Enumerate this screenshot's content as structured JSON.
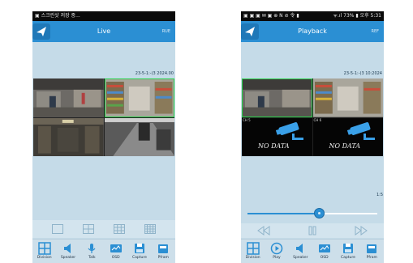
{
  "live": {
    "status_bar": {
      "left": "▣ 스크린샷 저장 중...",
      "right": ""
    },
    "title": "Live",
    "header_right": "RUE",
    "timestamp": "23-5-1:-(3 2024.00",
    "toolbar": [
      "Division",
      "Speaker",
      "Talk",
      "OSD",
      "Capture",
      "Pfram"
    ]
  },
  "playback": {
    "status_bar": {
      "left": "▣ ▣ ▣ ✉ ▣ ⊕ N ⊘ 令 ▮",
      "right": "ᯤ.ıl 73% ▮ 오후 5:31"
    },
    "title": "Playback",
    "header_right": "REF",
    "timestamp": "23-5-1:-(3 10:2024",
    "nodata_text": "NO DATA",
    "channel_labels": [
      "CH 5",
      "CH 6"
    ],
    "side_label": "1:5",
    "progress": 0.55,
    "toolbar": [
      "Division",
      "Play",
      "Speaker",
      "OSD",
      "Capture",
      "Pfram"
    ]
  },
  "colors": {
    "header": "#2b8fd3",
    "screen_bg": "#c5dbe8",
    "selection": "#29d24a",
    "icon": "#2b8fd3"
  },
  "icons": {
    "back": "arrow-back-icon",
    "layout": [
      "layout-1-icon",
      "layout-4-icon",
      "layout-9-icon",
      "layout-16-icon"
    ],
    "playback_controls": [
      "rewind-icon",
      "pause-icon",
      "forward-icon"
    ]
  }
}
